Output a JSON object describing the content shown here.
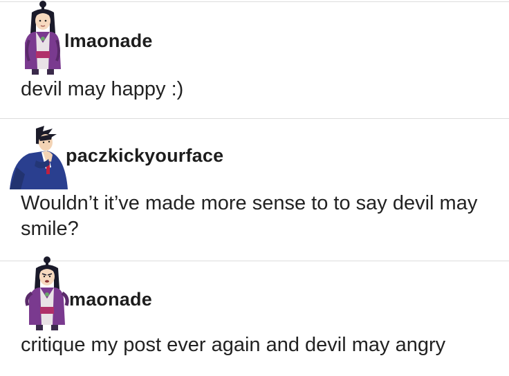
{
  "posts": [
    {
      "avatar_icon": "woman-with-topknot-avatar",
      "username": "lmaonade",
      "message": "devil may happy :)"
    },
    {
      "avatar_icon": "man-in-blue-suit-thinking-avatar",
      "username": "paczkickyourface",
      "message": "Wouldn’t it’ve made more sense to to say devil may smile?"
    },
    {
      "avatar_icon": "angry-woman-with-topknot-avatar",
      "username": "maonade",
      "message": "critique my post ever again and devil may angry"
    }
  ],
  "colors": {
    "text": "#222222",
    "divider": "#dcdcdc",
    "suit_blue": "#2a3f8f",
    "robe_purple": "#7a3a8f",
    "sash_magenta": "#b0306a"
  }
}
